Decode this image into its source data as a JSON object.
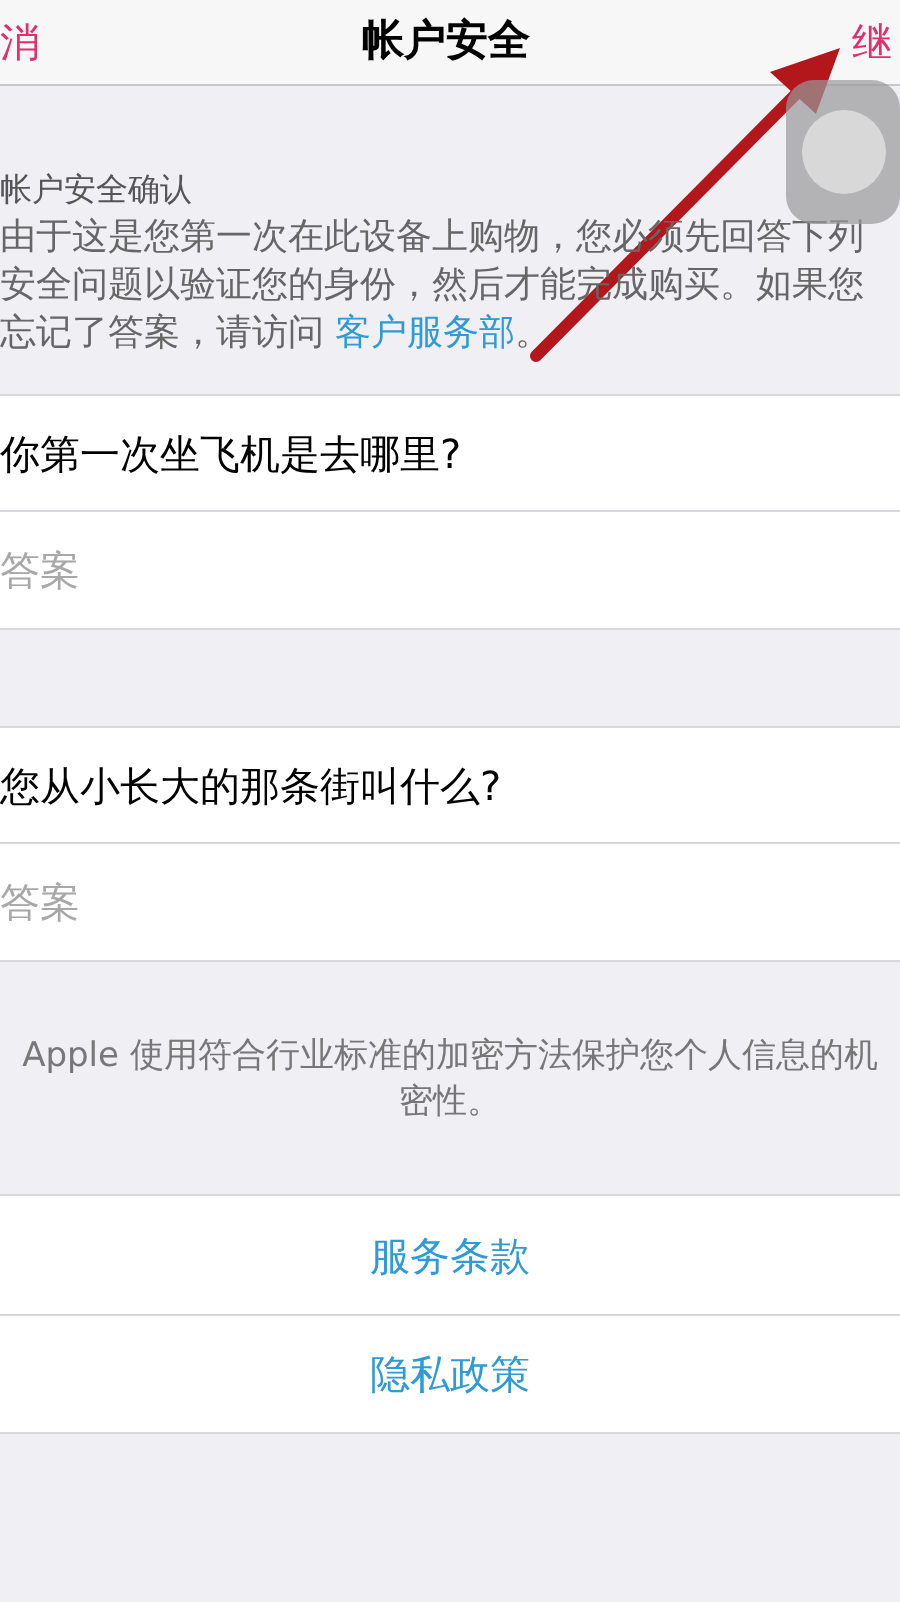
{
  "nav": {
    "left": "消",
    "title": "帐户安全",
    "right": "继"
  },
  "section_title": "帐户安全确认",
  "description": {
    "text": "由于这是您第一次在此设备上购物，您必须先回答下列安全问题以验证您的身份，然后才能完成购买。如果您忘记了答案，请访问 ",
    "link": "客户服务部",
    "end": "。"
  },
  "questions": [
    {
      "question": "你第一次坐飞机是去哪里?",
      "placeholder": "答案"
    },
    {
      "question": "您从小长大的那条街叫什么?",
      "placeholder": "答案"
    }
  ],
  "footer_note": "Apple 使用符合行业标准的加密方法保护您个人信息的机密性。",
  "links": [
    "服务条款",
    "隐私政策"
  ]
}
